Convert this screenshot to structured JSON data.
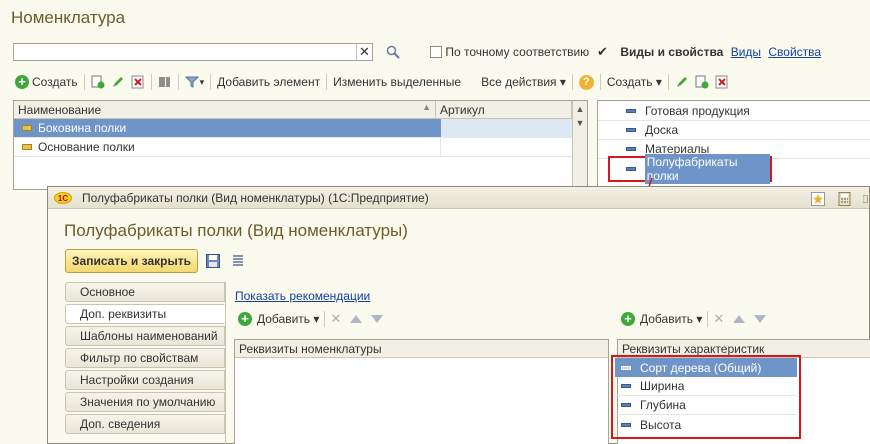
{
  "window": {
    "title": "Номенклатура"
  },
  "search": {
    "value": "",
    "placeholder": ""
  },
  "filters": {
    "exact_match_label": "По точному соответствию",
    "exact_match_checked": false,
    "types_props_label": "Виды и свойства",
    "types_props_checked": true,
    "link_types": "Виды",
    "link_props": "Свойства"
  },
  "toolbar": {
    "create": "Создать",
    "add_element": "Добавить элемент",
    "change_selected": "Изменить выделенные",
    "all_actions": "Все действия ▾",
    "create_right": "Создать ▾"
  },
  "list": {
    "col_name": "Наименование",
    "col_article": "Артикул",
    "rows": [
      {
        "name": "Боковина полки",
        "article": ""
      },
      {
        "name": "Основание полки",
        "article": ""
      }
    ]
  },
  "kinds": {
    "items": [
      {
        "label": "Готовая продукция"
      },
      {
        "label": "Доска"
      },
      {
        "label": "Материалы"
      },
      {
        "label": "Полуфабрикаты полки"
      }
    ]
  },
  "dialog": {
    "window_title": "Полуфабрикаты полки (Вид номенклатуры)  (1С:Предприятие)",
    "heading": "Полуфабрикаты полки (Вид номенклатуры)",
    "save_close": "Записать и закрыть",
    "show_recommendation": "Показать рекомендации",
    "add": "Добавить ▾",
    "add2": "Добавить ▾",
    "left_table_header": "Реквизиты номенклатуры",
    "right_table_header": "Реквизиты характеристик",
    "tabs": [
      {
        "label": "Основное"
      },
      {
        "label": "Доп. реквизиты"
      },
      {
        "label": "Шаблоны наименований"
      },
      {
        "label": "Фильтр по свойствам"
      },
      {
        "label": "Настройки создания"
      },
      {
        "label": "Значения по умолчанию"
      },
      {
        "label": "Доп. сведения"
      }
    ],
    "char_items": [
      {
        "label": "Сорт дерева (Общий)"
      },
      {
        "label": "Ширина"
      },
      {
        "label": "Глубина"
      },
      {
        "label": "Высота"
      }
    ]
  },
  "colors": {
    "accent_red": "#d8171d",
    "selection": "#6f95c8",
    "link": "#1040a8"
  }
}
